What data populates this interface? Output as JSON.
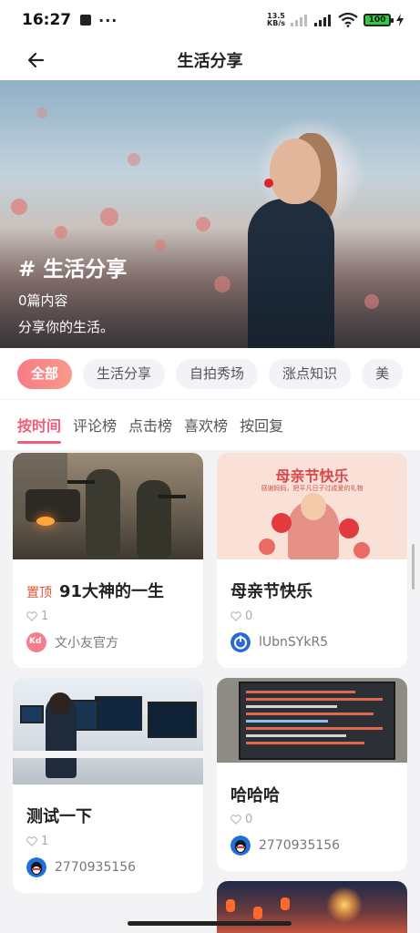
{
  "status_bar": {
    "time": "16:27",
    "net_speed_top": "13.5",
    "net_speed_bottom": "KB/s",
    "battery": "100"
  },
  "header": {
    "title": "生活分享",
    "back_icon": "arrow-left-icon"
  },
  "banner": {
    "title": "# 生活分享",
    "count": "0篇内容",
    "description": "分享你的生活。"
  },
  "categories": [
    "全部",
    "生活分享",
    "自拍秀场",
    "涨点知识",
    "美"
  ],
  "sort_tabs": [
    "按时间",
    "评论榜",
    "点击榜",
    "喜欢榜",
    "按回复"
  ],
  "posts": [
    {
      "pinned_label": "置顶",
      "title": "91大神的一生",
      "likes": "1",
      "author": "文小友官方"
    },
    {
      "title": "母亲节快乐",
      "likes": "0",
      "author": "lUbnSYkR5",
      "image_heading": "母亲节快乐",
      "image_subtitle": "感谢妈妈，把平凡日子过成爱的礼物"
    },
    {
      "title": "测试一下",
      "likes": "1",
      "author": "2770935156"
    },
    {
      "title": "哈哈哈",
      "likes": "0",
      "author": "2770935156"
    }
  ],
  "colors": {
    "accent": "#ef5d7a",
    "pin": "#e0513b",
    "chip_active_start": "#f77b86"
  }
}
